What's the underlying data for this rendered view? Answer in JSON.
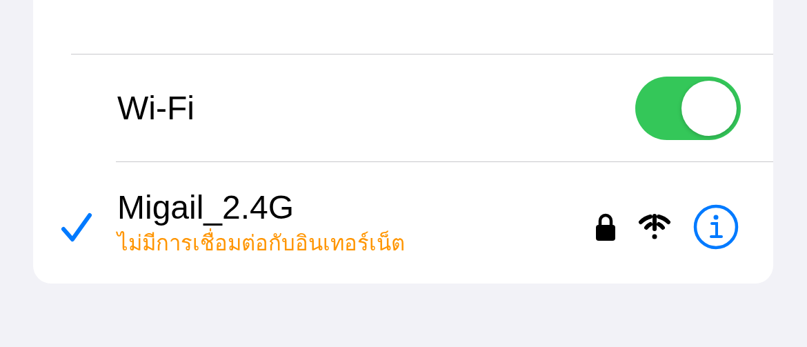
{
  "wifi": {
    "label": "Wi-Fi",
    "on": true
  },
  "networks": [
    {
      "name": "Migail_2.4G",
      "status": "ไม่มีการเชื่อมต่อกับอินเทอร์เน็ต",
      "selected": true,
      "locked": true
    }
  ]
}
